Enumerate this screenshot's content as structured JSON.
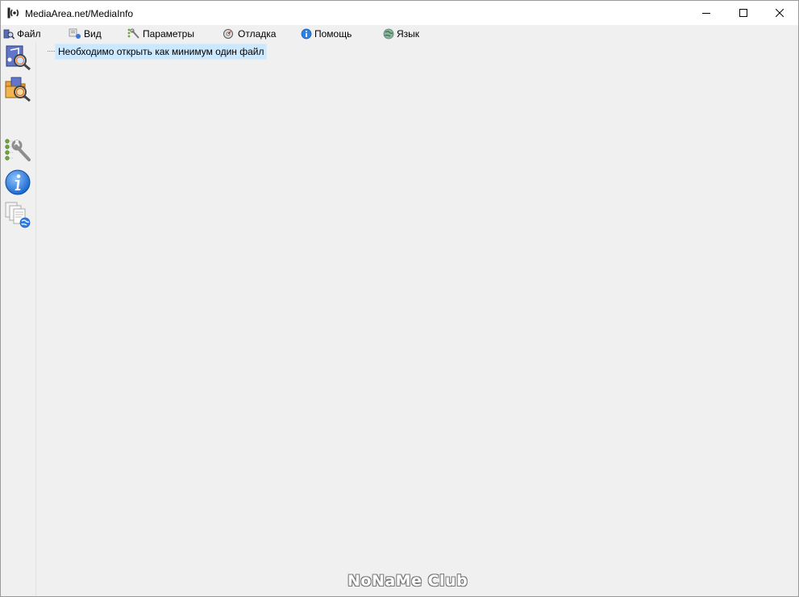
{
  "window": {
    "title": "MediaArea.net/MediaInfo",
    "icon": "mediainfo-app-icon"
  },
  "caption_buttons": {
    "minimize": "minimize-icon",
    "maximize": "maximize-icon",
    "close": "close-icon"
  },
  "menu": {
    "items": [
      {
        "label": "Файл",
        "icon": "file-icon"
      },
      {
        "label": "Вид",
        "icon": "view-icon"
      },
      {
        "label": "Параметры",
        "icon": "options-icon"
      },
      {
        "label": "Отладка",
        "icon": "debug-icon"
      },
      {
        "label": "Помощь",
        "icon": "help-icon"
      },
      {
        "label": "Язык",
        "icon": "language-globe-icon"
      }
    ]
  },
  "toolbar": {
    "buttons": [
      {
        "name": "open-file",
        "icon": "open-file-icon"
      },
      {
        "name": "open-folder",
        "icon": "open-folder-icon"
      },
      {
        "name": "preferences",
        "icon": "preferences-icon"
      },
      {
        "name": "about",
        "icon": "info-icon"
      },
      {
        "name": "web",
        "icon": "web-knowledge-icon"
      }
    ]
  },
  "content": {
    "tree_message": "Необходимо открыть как минимум один файл"
  },
  "watermark": "NoNaMe Club",
  "colors": {
    "selection": "#cce8ff",
    "window_bg": "#f0f0f0",
    "titlebar_bg": "#ffffff"
  }
}
